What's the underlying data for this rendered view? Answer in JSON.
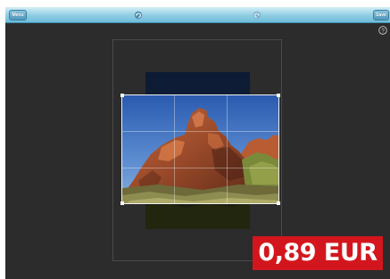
{
  "toolbar": {
    "menu_label": "Menu",
    "save_label": "Save",
    "undo_icon": "undo-icon",
    "redo_icon": "redo-icon"
  },
  "help": {
    "icon": "help-icon",
    "glyph": "?"
  },
  "overlay": {
    "price": "0,89 EUR"
  },
  "colors": {
    "toolbar": "#8fcde3",
    "background": "#2c2c2c",
    "price_tag": "#d3161d"
  }
}
